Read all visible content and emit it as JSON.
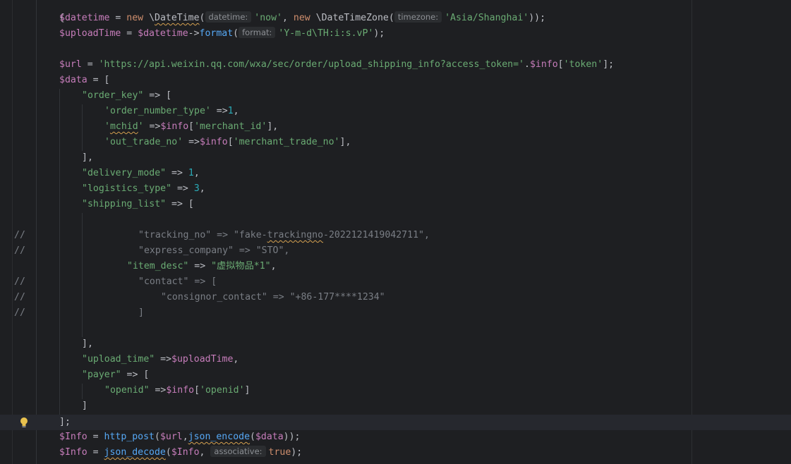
{
  "editor": {
    "open_brace": "{",
    "line_datetime": {
      "var": "$datetime",
      "eq": " = ",
      "new1": "new",
      "cls1": " \\DateTime(",
      "hint1": "datetime:",
      "arg1": "'now'",
      "sep": ", ",
      "new2": "new",
      "cls2": " \\DateTimeZone(",
      "hint2": "timezone:",
      "arg2": "'Asia/Shanghai'",
      "end": "));"
    },
    "line_upload": {
      "var": "$uploadTime",
      "eq": " = ",
      "var2": "$datetime",
      "arrow": "->",
      "fn": "format",
      "paren": "(",
      "hint": "format:",
      "arg": "'Y-m-d\\TH:i:s.vP'",
      "end": ");"
    },
    "line_url": {
      "var": "$url",
      "eq": " = ",
      "str": "'https://api.weixin.qq.com/wxa/sec/order/upload_shipping_info?access_token='",
      "dot": ".",
      "var2": "$info",
      "br1": "[",
      "key": "'token'",
      "end": "];"
    },
    "line_data": {
      "var": "$data",
      "rest": " = ["
    },
    "order_key": {
      "key": "\"order_key\"",
      "rest": " => ["
    },
    "order_number_type": {
      "key": "'order_number_type'",
      "arrow": " =>",
      "num": "1",
      "end": ","
    },
    "mchid": {
      "q1": "'",
      "key": "mchid",
      "q2": "'",
      "arrow": " =>",
      "var": "$info",
      "br": "[",
      "sub": "'merchant_id'",
      "end": "],"
    },
    "out_trade_no": {
      "key": "'out_trade_no'",
      "arrow": " =>",
      "var": "$info",
      "br": "[",
      "sub": "'merchant_trade_no'",
      "end": "],"
    },
    "close1": "],",
    "delivery_mode": {
      "key": "\"delivery_mode\"",
      "arrow": " => ",
      "num": "1",
      "end": ","
    },
    "logistics_type": {
      "key": "\"logistics_type\"",
      "arrow": " => ",
      "num": "3",
      "end": ","
    },
    "shipping_list": {
      "key": "\"shipping_list\"",
      "rest": " => ["
    },
    "comment_marker": "//",
    "c_tracking": {
      "a": "\"tracking_no\" => \"fake-",
      "b": "trackingno",
      "c": "-2022121419042711\","
    },
    "c_express": "\"express_company\" => \"STO\",",
    "item_desc": {
      "key": "\"item_desc\"",
      "arrow": " => ",
      "val": "\"虚拟物品*1\"",
      "end": ","
    },
    "c_contact": "\"contact\" => [",
    "c_consignor": "\"consignor_contact\" => \"+86-177****1234\"",
    "c_close": "]",
    "close2": "],",
    "upload_time": {
      "key": "\"upload_time\"",
      "arrow": " =>",
      "var": "$uploadTime",
      "end": ","
    },
    "payer": {
      "key": "\"payer\"",
      "rest": " => ["
    },
    "openid": {
      "key": "\"openid\"",
      "arrow": " =>",
      "var": "$info",
      "br": "[",
      "sub": "'openid'",
      "end": "]"
    },
    "close3": "]",
    "close4": "];",
    "line_post": {
      "var": "$Info",
      "eq": " = ",
      "fn1": "http_post",
      "p1": "(",
      "var2": "$url",
      "comma": ",",
      "fn2": "json_encode",
      "p2": "(",
      "var3": "$data",
      "end": "));"
    },
    "line_decode": {
      "var": "$Info",
      "eq": " = ",
      "fn": "json_decode",
      "p": "(",
      "var2": "$Info",
      "comma": ", ",
      "hint": "associative:",
      "kw": "true",
      "end": ");"
    }
  }
}
